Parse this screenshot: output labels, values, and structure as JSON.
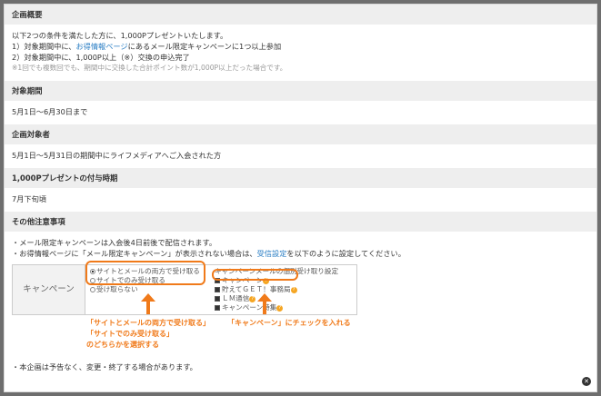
{
  "sections": {
    "overview": {
      "heading": "企画概要",
      "line1": "以下2つの条件を満たした方に、1,000Pプレゼントいたします。",
      "line2_pre": "1）対象期間中に、",
      "line2_link": "お得情報ページ",
      "line2_post": "にあるメール限定キャンペーンに1つ以上参加",
      "line3": "2）対象期間中に、1,000P以上（※）交換の申込完了",
      "note": "※1回でも複数回でも、期間中に交換した合計ポイント数が1,000P以上だった場合です。"
    },
    "period": {
      "heading": "対象期間",
      "body": "5月1日～6月30日まで"
    },
    "target": {
      "heading": "企画対象者",
      "body": "5月1日～5月31日の期間中にライフメディアへご入会された方"
    },
    "timing": {
      "heading": "1,000Pプレゼントの付与時期",
      "body": "7月下旬頃"
    },
    "notes": {
      "heading": "その他注意事項",
      "line1": "・メール限定キャンペーンは入会後4日前後で配信されます。",
      "line2_pre": "・お得情報ページに「メール限定キャンペーン」が表示されない場合は、",
      "line2_link": "受信設定",
      "line2_post": "を以下のように設定してください。"
    }
  },
  "setting_table": {
    "label": "キャンペーン",
    "radio_options": [
      "サイトとメールの両方で受け取る",
      "サイトでのみ受け取る",
      "受け取らない"
    ],
    "selected_radio": "サイトとメールの両方で受け取る",
    "checkbox_header": "キャンペーンメールの個別受け取り設定",
    "checkbox_items": [
      "キャンペーン",
      "貯えてＧＥＴ！事務局",
      "ＬＭ通信",
      "キャンペーン特集"
    ],
    "help_icon": "question-mark-icon"
  },
  "annotations": {
    "left": [
      "「サイトとメールの両方で受け取る」",
      "「サイトでのみ受け取る」",
      "のどちらかを選択する"
    ],
    "right": "「キャンペーン」にチェックを入れる",
    "color": "#f07a1a"
  },
  "footer_note": "・本企画は予告なく、変更・終了する場合があります。",
  "close_icon": "close-icon"
}
